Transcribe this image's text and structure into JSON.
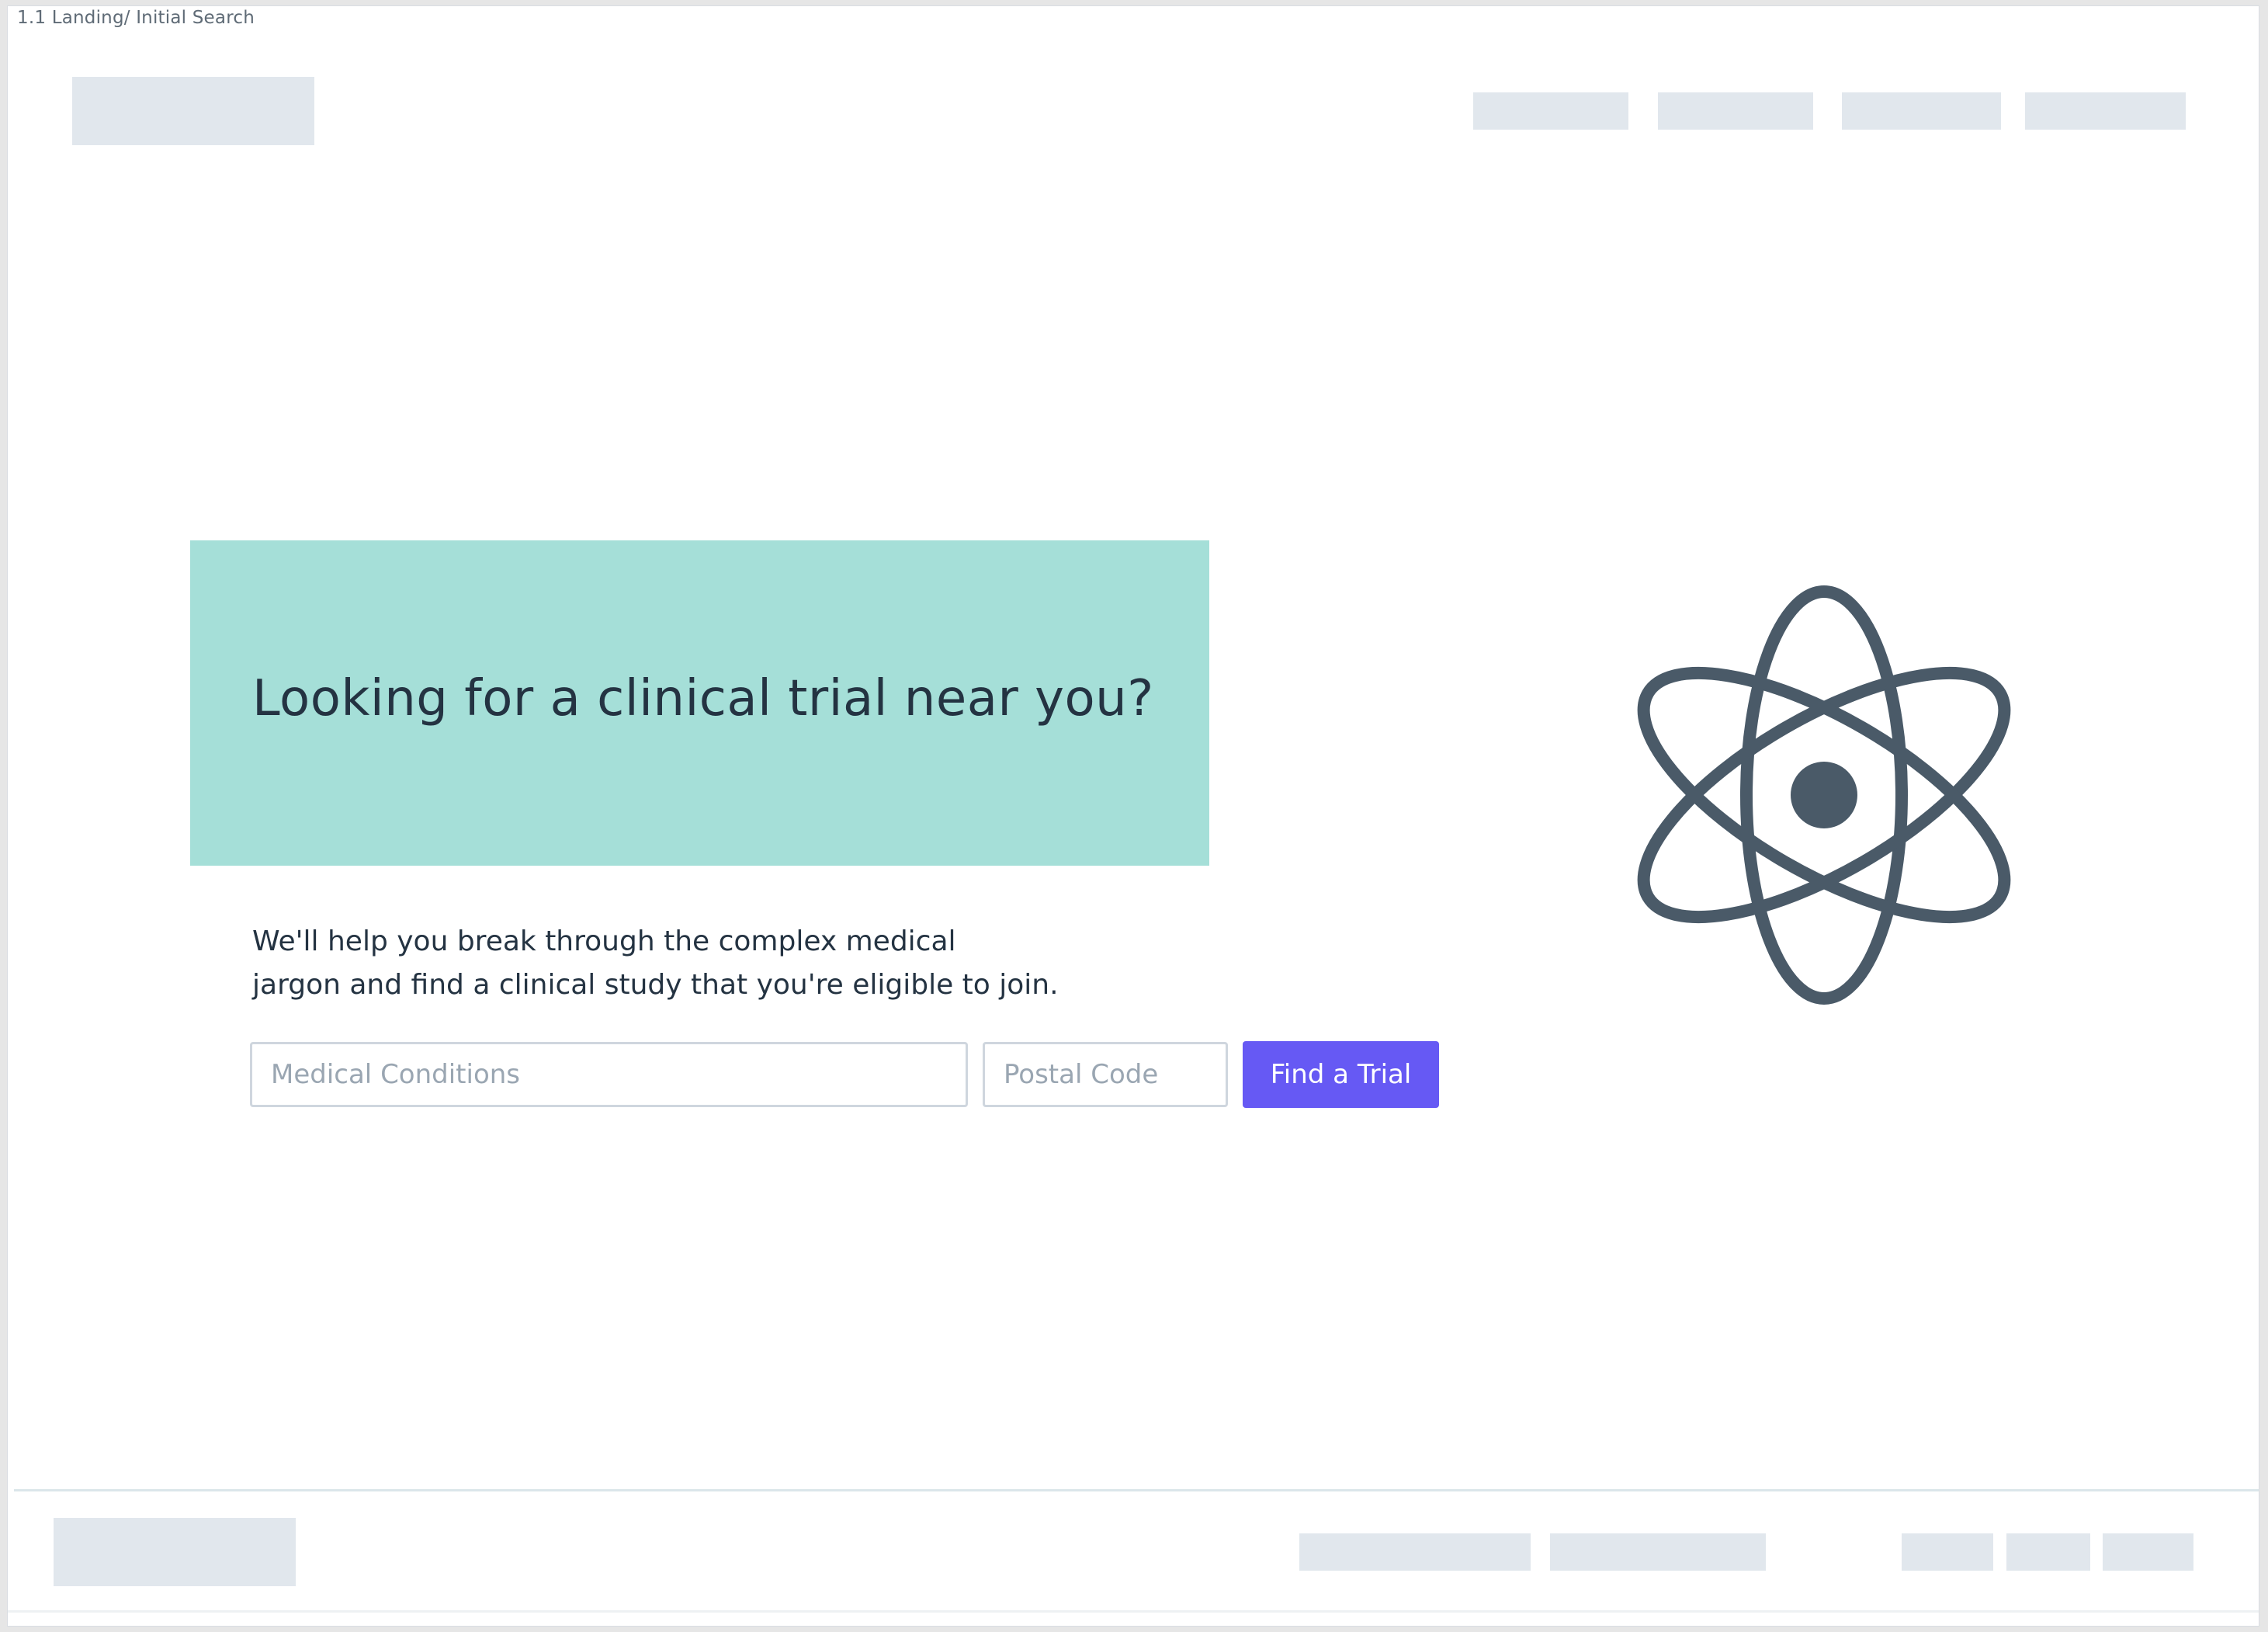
{
  "frame": {
    "label": "1.1 Landing/ Initial Search"
  },
  "hero": {
    "title": "Looking for a clinical trial near you?",
    "subtitle_line1": "We'll help you break through the complex medical",
    "subtitle_line2": "jargon and find a clinical study that you're eligible to join."
  },
  "search": {
    "conditions_placeholder": "Medical Conditions",
    "conditions_value": "",
    "postal_placeholder": "Postal Code",
    "postal_value": "",
    "button_label": "Find a Trial"
  },
  "illustration": {
    "icon": "atom-icon"
  },
  "colors": {
    "hero_background": "#a5dfd8",
    "primary_button": "#6659f4",
    "text_dark": "#243342",
    "placeholder_block": "#e1e7ed",
    "icon": "#4a5a68"
  }
}
